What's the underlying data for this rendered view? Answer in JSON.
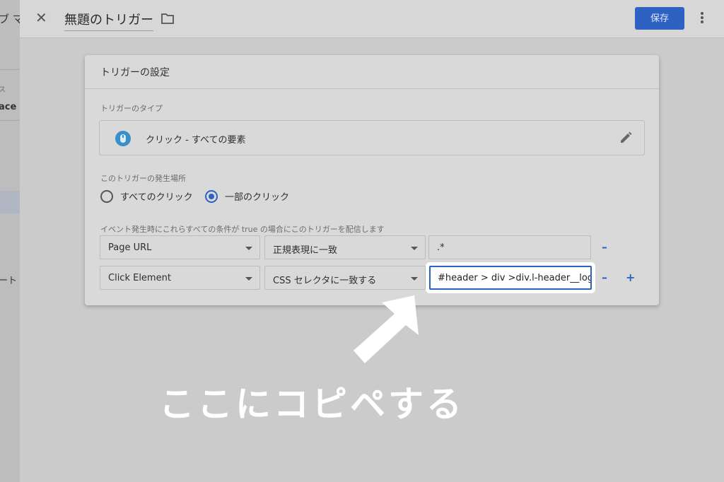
{
  "background_app": {
    "fragments": [
      "ブ マ",
      "ス",
      "ace",
      "ート",
      "ス"
    ]
  },
  "header": {
    "title": "無題のトリガー",
    "save_label": "保存"
  },
  "card": {
    "title": "トリガーの設定",
    "trigger_type_label": "トリガーのタイプ",
    "trigger_type_value": "クリック - すべての要素",
    "fire_on_label": "このトリガーの発生場所",
    "radio_all": "すべてのクリック",
    "radio_some": "一部のクリック",
    "radio_selected": "一部のクリック",
    "conditions_label": "イベント発生時にこれらすべての条件が true の場合にこのトリガーを配信します",
    "conditions": [
      {
        "variable": "Page URL",
        "operator": "正規表現に一致",
        "value": ".*"
      },
      {
        "variable": "Click Element",
        "operator": "CSS セレクタに一致する",
        "value": "#header > div >div.l-header__logo :"
      }
    ]
  },
  "annotation": {
    "caption": "ここにコピペする"
  },
  "colors": {
    "accent": "#2e62c2",
    "highlight_box": "#ffffff",
    "caption_text": "#ffffff"
  }
}
